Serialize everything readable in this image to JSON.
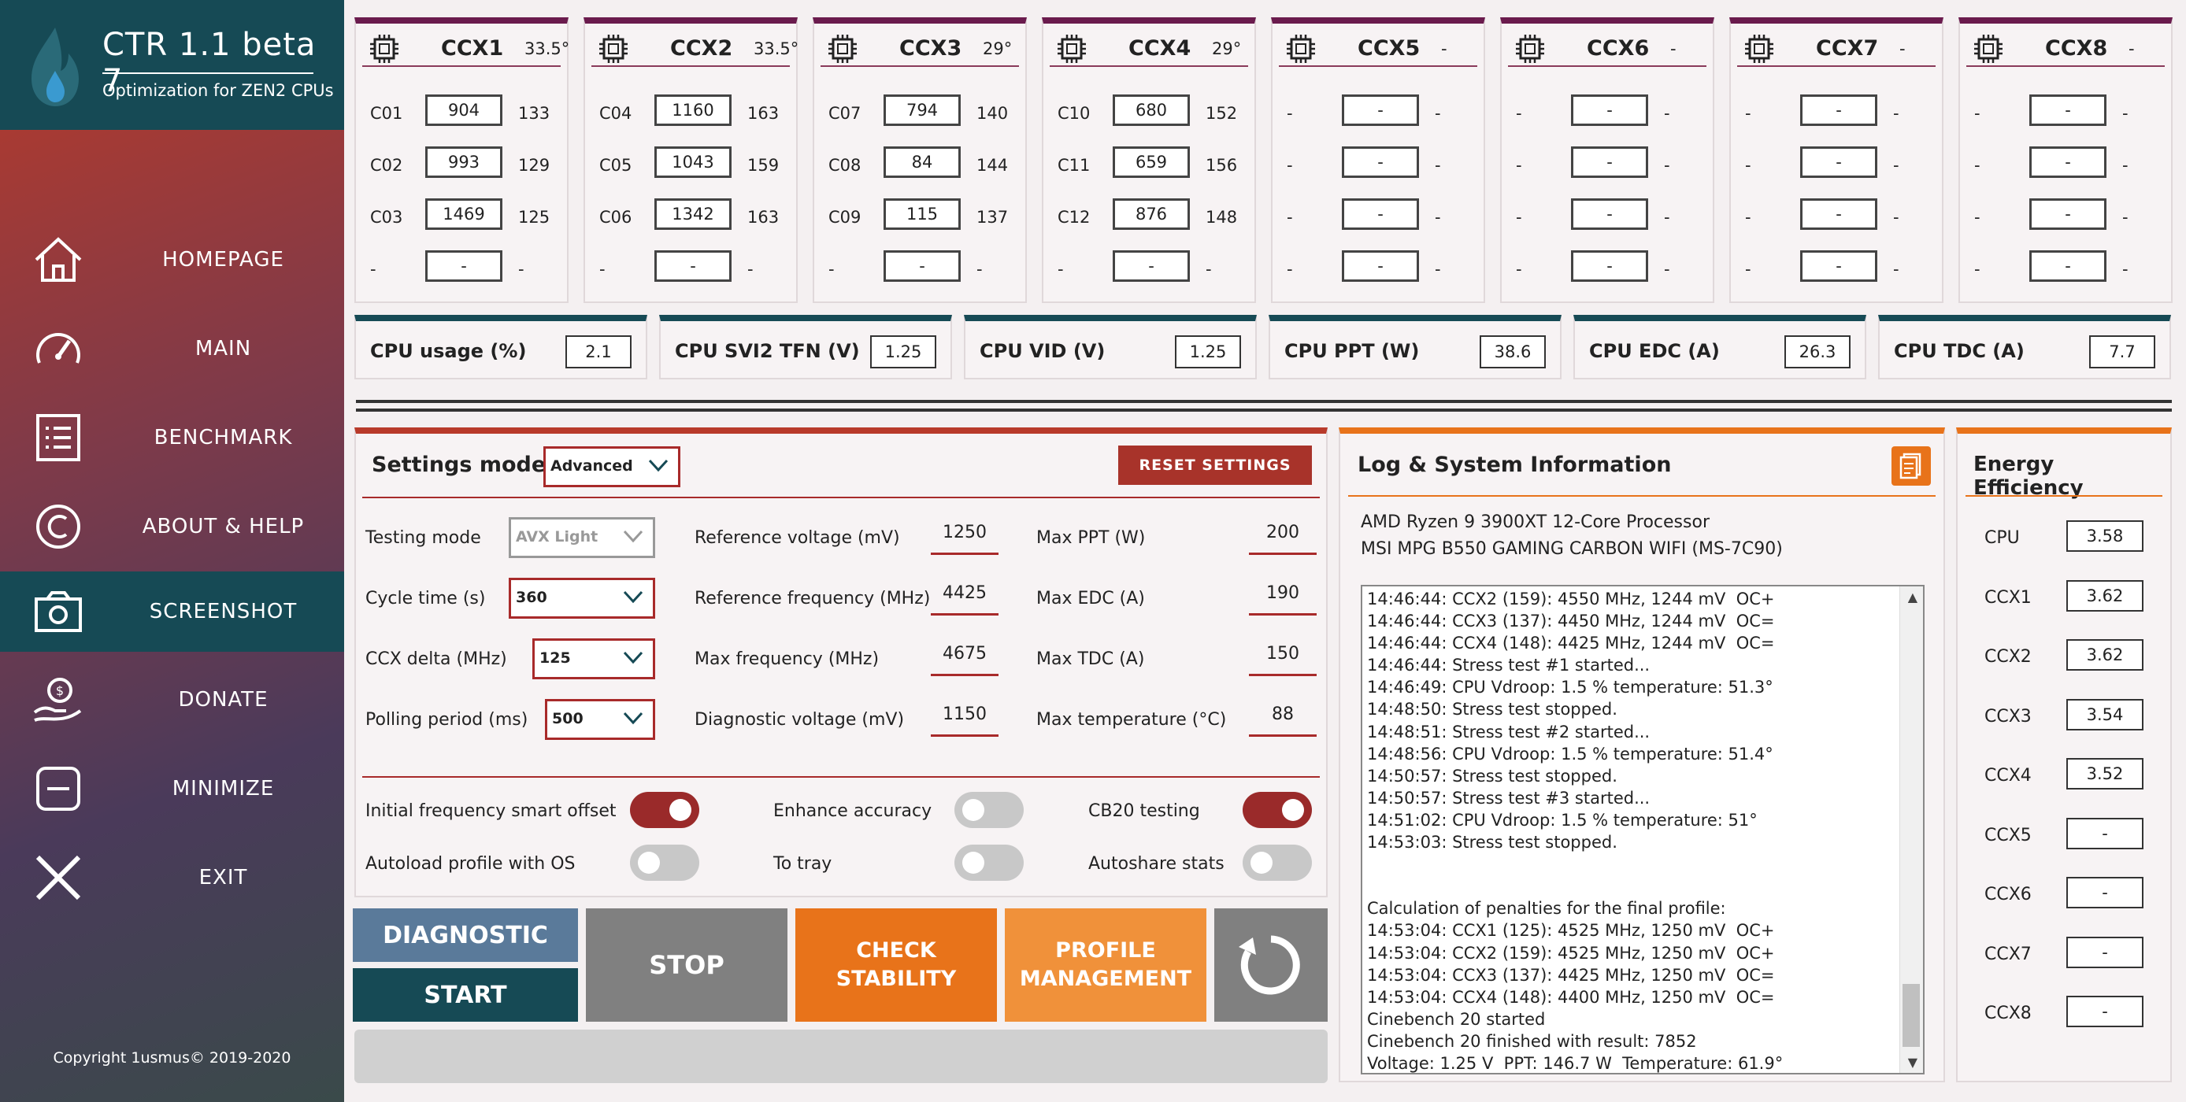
{
  "app": {
    "title": "CTR 1.1 beta 7",
    "subtitle": "Optimization for ZEN2 CPUs",
    "copyright": "Copyright 1usmus© 2019-2020"
  },
  "sidebar": {
    "items": [
      {
        "label": "HOMEPAGE",
        "icon": "home-icon"
      },
      {
        "label": "MAIN",
        "icon": "speedometer-icon"
      },
      {
        "label": "BENCHMARK",
        "icon": "list-icon"
      },
      {
        "label": "ABOUT & HELP",
        "icon": "copyright-icon"
      },
      {
        "label": "SCREENSHOT",
        "icon": "camera-icon",
        "active": true
      },
      {
        "label": "DONATE",
        "icon": "donate-icon"
      },
      {
        "label": "MINIMIZE",
        "icon": "minimize-icon"
      },
      {
        "label": "EXIT",
        "icon": "close-icon"
      }
    ]
  },
  "ccx": [
    {
      "name": "CCX1",
      "temp": "33.5°",
      "rows": [
        {
          "id": "C01",
          "value": "904",
          "num": "133"
        },
        {
          "id": "C02",
          "value": "993",
          "num": "129"
        },
        {
          "id": "C03",
          "value": "1469",
          "num": "125"
        },
        {
          "id": "-",
          "value": "-",
          "num": "-"
        }
      ]
    },
    {
      "name": "CCX2",
      "temp": "33.5°",
      "rows": [
        {
          "id": "C04",
          "value": "1160",
          "num": "163"
        },
        {
          "id": "C05",
          "value": "1043",
          "num": "159"
        },
        {
          "id": "C06",
          "value": "1342",
          "num": "163"
        },
        {
          "id": "-",
          "value": "-",
          "num": "-"
        }
      ]
    },
    {
      "name": "CCX3",
      "temp": "29°",
      "rows": [
        {
          "id": "C07",
          "value": "794",
          "num": "140"
        },
        {
          "id": "C08",
          "value": "84",
          "num": "144"
        },
        {
          "id": "C09",
          "value": "115",
          "num": "137"
        },
        {
          "id": "-",
          "value": "-",
          "num": "-"
        }
      ]
    },
    {
      "name": "CCX4",
      "temp": "29°",
      "rows": [
        {
          "id": "C10",
          "value": "680",
          "num": "152"
        },
        {
          "id": "C11",
          "value": "659",
          "num": "156"
        },
        {
          "id": "C12",
          "value": "876",
          "num": "148"
        },
        {
          "id": "-",
          "value": "-",
          "num": "-"
        }
      ]
    },
    {
      "name": "CCX5",
      "temp": "-",
      "rows": [
        {
          "id": "-",
          "value": "-",
          "num": "-"
        },
        {
          "id": "-",
          "value": "-",
          "num": "-"
        },
        {
          "id": "-",
          "value": "-",
          "num": "-"
        },
        {
          "id": "-",
          "value": "-",
          "num": "-"
        }
      ]
    },
    {
      "name": "CCX6",
      "temp": "-",
      "rows": [
        {
          "id": "-",
          "value": "-",
          "num": "-"
        },
        {
          "id": "-",
          "value": "-",
          "num": "-"
        },
        {
          "id": "-",
          "value": "-",
          "num": "-"
        },
        {
          "id": "-",
          "value": "-",
          "num": "-"
        }
      ]
    },
    {
      "name": "CCX7",
      "temp": "-",
      "rows": [
        {
          "id": "-",
          "value": "-",
          "num": "-"
        },
        {
          "id": "-",
          "value": "-",
          "num": "-"
        },
        {
          "id": "-",
          "value": "-",
          "num": "-"
        },
        {
          "id": "-",
          "value": "-",
          "num": "-"
        }
      ]
    },
    {
      "name": "CCX8",
      "temp": "-",
      "rows": [
        {
          "id": "-",
          "value": "-",
          "num": "-"
        },
        {
          "id": "-",
          "value": "-",
          "num": "-"
        },
        {
          "id": "-",
          "value": "-",
          "num": "-"
        },
        {
          "id": "-",
          "value": "-",
          "num": "-"
        }
      ]
    }
  ],
  "stats": [
    {
      "label": "CPU usage (%)",
      "value": "2.1"
    },
    {
      "label": "CPU SVI2 TFN (V)",
      "value": "1.25"
    },
    {
      "label": "CPU VID (V)",
      "value": "1.25"
    },
    {
      "label": "CPU PPT (W)",
      "value": "38.6"
    },
    {
      "label": "CPU EDC (A)",
      "value": "26.3"
    },
    {
      "label": "CPU TDC (A)",
      "value": "7.7"
    }
  ],
  "settings": {
    "title": "Settings mode",
    "mode": "Advanced",
    "reset_label": "RESET SETTINGS",
    "left": [
      {
        "label": "Testing mode",
        "value": "AVX Light"
      },
      {
        "label": "Cycle time (s)",
        "value": "360"
      },
      {
        "label": "CCX delta (MHz)",
        "value": "125"
      },
      {
        "label": "Polling period (ms)",
        "value": "500"
      }
    ],
    "middle": [
      {
        "label": "Reference voltage (mV)",
        "value": "1250"
      },
      {
        "label": "Reference frequency (MHz)",
        "value": "4425"
      },
      {
        "label": "Max frequency (MHz)",
        "value": "4675"
      },
      {
        "label": "Diagnostic voltage (mV)",
        "value": "1150"
      }
    ],
    "right": [
      {
        "label": "Max PPT (W)",
        "value": "200"
      },
      {
        "label": "Max EDC (A)",
        "value": "190"
      },
      {
        "label": "Max TDC (A)",
        "value": "150"
      },
      {
        "label": "Max temperature (°C)",
        "value": "88"
      }
    ],
    "toggles": [
      {
        "label": "Initial frequency smart offset",
        "on": true
      },
      {
        "label": "Enhance accuracy",
        "on": false
      },
      {
        "label": "CB20 testing",
        "on": true
      },
      {
        "label": "Autoload profile with OS",
        "on": false
      },
      {
        "label": "To tray",
        "on": false
      },
      {
        "label": "Autoshare stats",
        "on": false
      }
    ]
  },
  "buttons": {
    "diagnostic": "DIAGNOSTIC",
    "start": "START",
    "stop": "STOP",
    "check_1": "CHECK",
    "check_2": "STABILITY",
    "profile_1": "PROFILE",
    "profile_2": "MANAGEMENT"
  },
  "log": {
    "title": "Log & System Information",
    "cpu": "AMD Ryzen 9 3900XT 12-Core Processor",
    "board": "MSI MPG B550 GAMING CARBON WIFI (MS-7C90)",
    "lines": "14:46:44: CCX2 (159): 4550 MHz, 1244 mV  OC+\n14:46:44: CCX3 (137): 4450 MHz, 1244 mV  OC=\n14:46:44: CCX4 (148): 4425 MHz, 1244 mV  OC=\n14:46:44: Stress test #1 started...\n14:46:49: CPU Vdroop: 1.5 % temperature: 51.3°\n14:48:50: Stress test stopped.\n14:48:51: Stress test #2 started...\n14:48:56: CPU Vdroop: 1.5 % temperature: 51.4°\n14:50:57: Stress test stopped.\n14:50:57: Stress test #3 started...\n14:51:02: CPU Vdroop: 1.5 % temperature: 51°\n14:53:03: Stress test stopped.\n\n\nCalculation of penalties for the final profile:\n14:53:04: CCX1 (125): 4525 MHz, 1250 mV  OC+\n14:53:04: CCX2 (159): 4525 MHz, 1250 mV  OC+\n14:53:04: CCX3 (137): 4425 MHz, 1250 mV  OC=\n14:53:04: CCX4 (148): 4400 MHz, 1250 mV  OC=\nCinebench 20 started\nCinebench 20 finished with result: 7852\nVoltage: 1.25 V  PPT: 146.7 W  Temperature: 61.9°"
  },
  "energy": {
    "title": "Energy Efficiency",
    "rows": [
      {
        "label": "CPU",
        "value": "3.58"
      },
      {
        "label": "CCX1",
        "value": "3.62"
      },
      {
        "label": "CCX2",
        "value": "3.62"
      },
      {
        "label": "CCX3",
        "value": "3.54"
      },
      {
        "label": "CCX4",
        "value": "3.52"
      },
      {
        "label": "CCX5",
        "value": "-"
      },
      {
        "label": "CCX6",
        "value": "-"
      },
      {
        "label": "CCX7",
        "value": "-"
      },
      {
        "label": "CCX8",
        "value": "-"
      }
    ]
  },
  "colors": {
    "accent_red": "#a8332a",
    "teal": "#164a55",
    "orange": "#e8731a",
    "orange_light": "#f0913a",
    "purple": "#6a1b4d",
    "diag_blue": "#5a7a9a",
    "stop_gray": "#808080"
  }
}
